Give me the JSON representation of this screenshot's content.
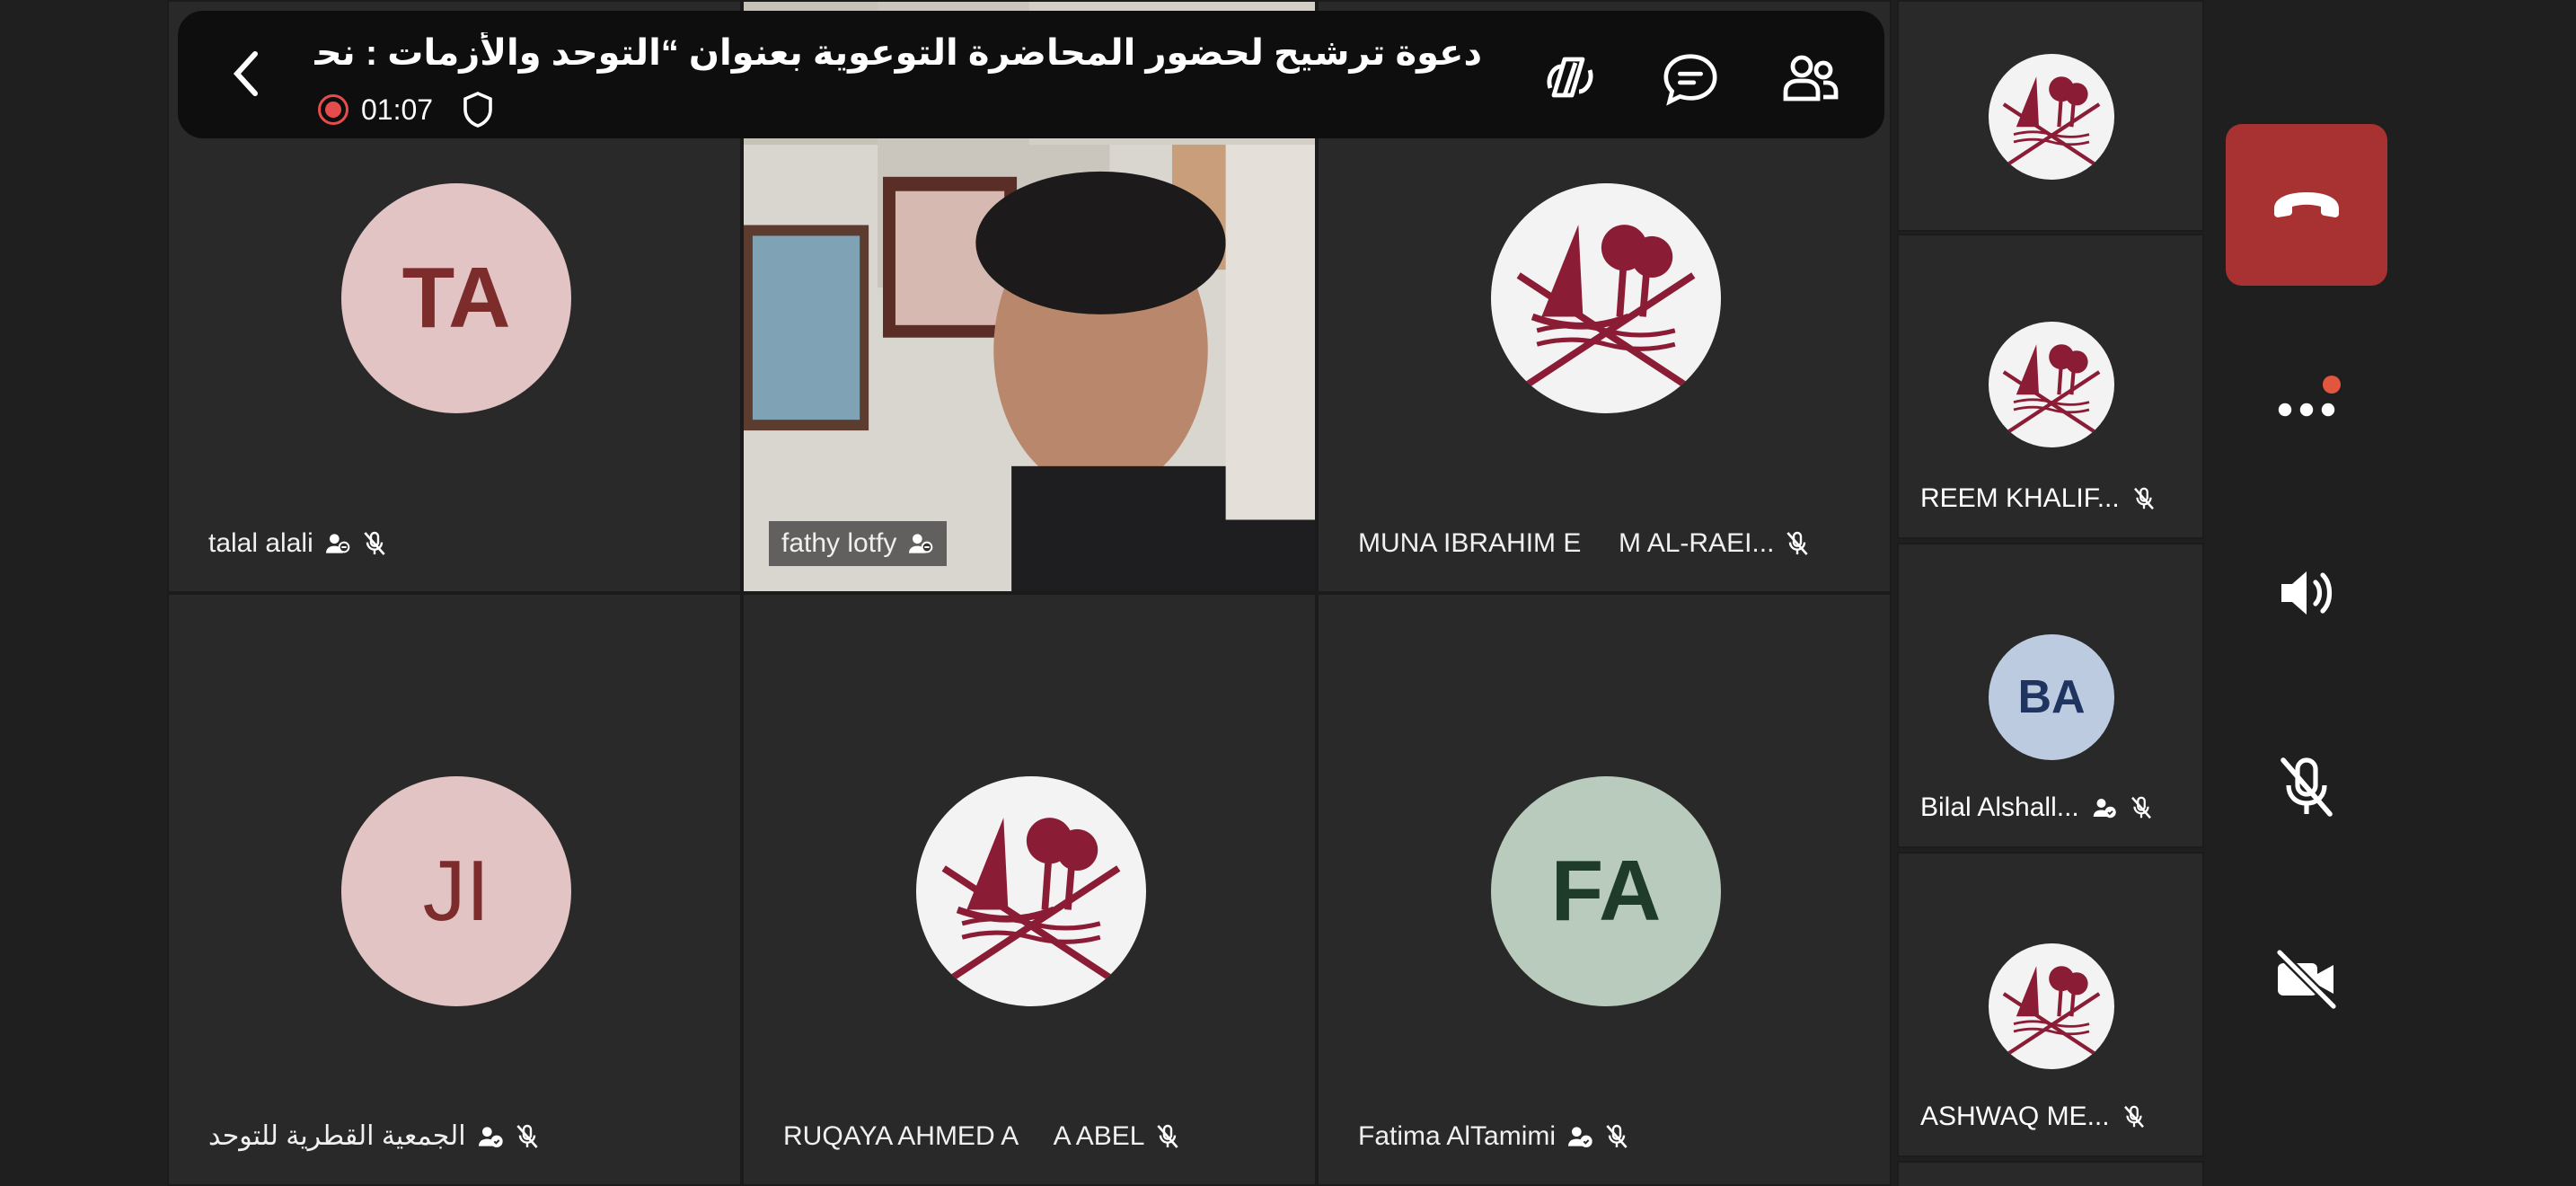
{
  "header": {
    "title": "دعوة ترشيح لحضور المحاضرة التوعوية بعنوان “التوحد والأزمات : نحو...",
    "recording_time": "01:07"
  },
  "grid": [
    {
      "name": "talal alali",
      "initials": "TA",
      "avatar_bg": "#e2c4c4",
      "avatar_fg": "#7d2c2c"
    },
    {
      "name": "fathy lotfy",
      "initials": "",
      "type": "video"
    },
    {
      "name": "MUNA IBRAHIM E     M AL-RAEI...",
      "initials": "",
      "type": "logo"
    },
    {
      "name": "الجمعية القطرية للتوحد",
      "initials": "JI",
      "avatar_bg": "#e2c4c4",
      "avatar_fg": "#7d2c2c"
    },
    {
      "name": "RUQAYA AHMED A     A ABEL",
      "initials": "",
      "type": "logo"
    },
    {
      "name": "Fatima AlTamimi",
      "initials": "FA",
      "avatar_bg": "#b9cbbd",
      "avatar_fg": "#1f3b2a"
    }
  ],
  "side": [
    {
      "name": "",
      "initials": "",
      "type": "logo"
    },
    {
      "name": "REEM KHALIF...",
      "initials": "",
      "type": "logo"
    },
    {
      "name": "Bilal Alshall...",
      "initials": "BA",
      "avatar_bg": "#bccbe0",
      "avatar_fg": "#1f3560"
    },
    {
      "name": "ASHWAQ ME...",
      "initials": "",
      "type": "logo"
    }
  ],
  "colors": {
    "hangup": "#a83232",
    "recording": "#e74c4c",
    "notify_dot": "#e2553f"
  }
}
